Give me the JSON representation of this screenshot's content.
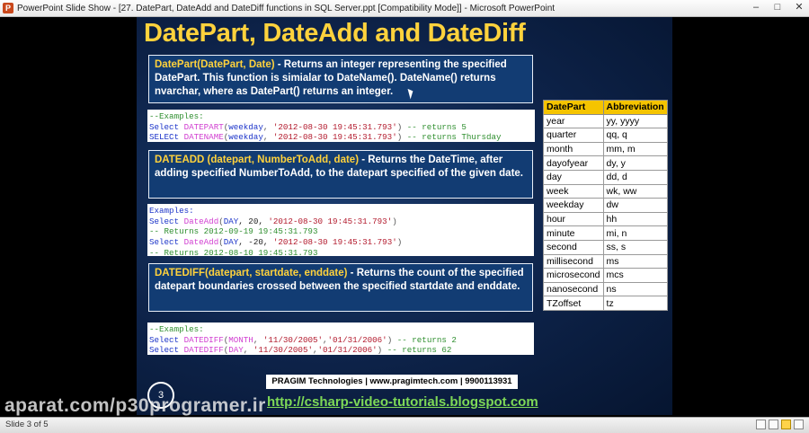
{
  "window": {
    "title": "PowerPoint Slide Show - [27. DatePart, DateAdd and DateDiff functions in SQL Server.ppt [Compatibility Mode]] - Microsoft PowerPoint",
    "app_icon": "P"
  },
  "slide": {
    "title": "DatePart, DateAdd and DateDiff",
    "datepart": {
      "sig": "DatePart(DatePart, Date)",
      "desc": " - Returns an integer representing the specified DatePart. This function is simialar to DateName(). DateName() returns nvarchar, where as DatePart() returns an integer."
    },
    "code1": {
      "l0": "--Examples:",
      "l1a": "Select ",
      "l1b": "DATEPART",
      "l1c": "(",
      "l1d": "weekday",
      "l1e": ", ",
      "l1f": "'2012-08-30 19:45:31.793'",
      "l1g": ") ",
      "l1h": "-- returns 5",
      "l2a": "SELECt ",
      "l2b": "DATENAME",
      "l2c": "(",
      "l2d": "weekday",
      "l2e": ", ",
      "l2f": "'2012-08-30 19:45:31.793'",
      "l2g": ") ",
      "l2h": "-- returns Thursday"
    },
    "dateadd": {
      "sig": "DATEADD (datepart, NumberToAdd, date)",
      "desc": " - Returns the DateTime, after adding specified NumberToAdd, to the datepart specified of the given date."
    },
    "code2": {
      "l0": "Examples:",
      "l1a": "Select ",
      "l1b": "DateAdd",
      "l1c": "(",
      "l1d": "DAY",
      "l1e": ", 20, ",
      "l1f": "'2012-08-30 19:45:31.793'",
      "l1g": ")",
      "l2": "-- Returns 2012-09-19 19:45:31.793",
      "l3a": "Select ",
      "l3b": "DateAdd",
      "l3c": "(",
      "l3d": "DAY",
      "l3e": ", -20, ",
      "l3f": "'2012-08-30 19:45:31.793'",
      "l3g": ")",
      "l4": "-- Returns 2012-08-10 19:45:31.793"
    },
    "datediff": {
      "sig": "DATEDIFF(datepart, startdate, enddate)",
      "desc": " - Returns the count of the specified datepart boundaries crossed between the specified startdate and enddate."
    },
    "code3": {
      "l0": "--Examples:",
      "l1a": "Select ",
      "l1b": "DATEDIFF",
      "l1c": "(",
      "l1d": "MONTH",
      "l1e": ", ",
      "l1f": "'11/30/2005'",
      "l1g": ",",
      "l1h": "'01/31/2006'",
      "l1i": ") ",
      "l1j": "-- returns 2",
      "l2a": "Select ",
      "l2b": "DATEDIFF",
      "l2c": "(",
      "l2d": "DAY",
      "l2e": ", ",
      "l2f": "'11/30/2005'",
      "l2g": ",",
      "l2h": "'01/31/2006'",
      "l2i": ") ",
      "l2j": "-- returns 62"
    },
    "table": {
      "headers": [
        "DatePart",
        "Abbreviation"
      ],
      "rows": [
        [
          "year",
          "yy, yyyy"
        ],
        [
          "quarter",
          "qq, q"
        ],
        [
          "month",
          "mm, m"
        ],
        [
          "dayofyear",
          "dy, y"
        ],
        [
          "day",
          "dd, d"
        ],
        [
          "week",
          "wk, ww"
        ],
        [
          "weekday",
          "dw"
        ],
        [
          "hour",
          "hh"
        ],
        [
          "minute",
          "mi, n"
        ],
        [
          "second",
          "ss, s"
        ],
        [
          "millisecond",
          "ms"
        ],
        [
          "microsecond",
          "mcs"
        ],
        [
          "nanosecond",
          "ns"
        ],
        [
          "TZoffset",
          "tz"
        ]
      ]
    },
    "slide_number": "3",
    "footer": "PRAGIM Technologies | www.pragimtech.com | 9900113931",
    "footer_url": "http://csharp-video-tutorials.blogspot.com"
  },
  "status": {
    "slide_info": "Slide 3 of 5"
  },
  "watermark": "aparat.com/p30programer.ir",
  "colors": {
    "title": "#ffd23c",
    "table_header": "#f5c400",
    "url": "#7ed957"
  }
}
